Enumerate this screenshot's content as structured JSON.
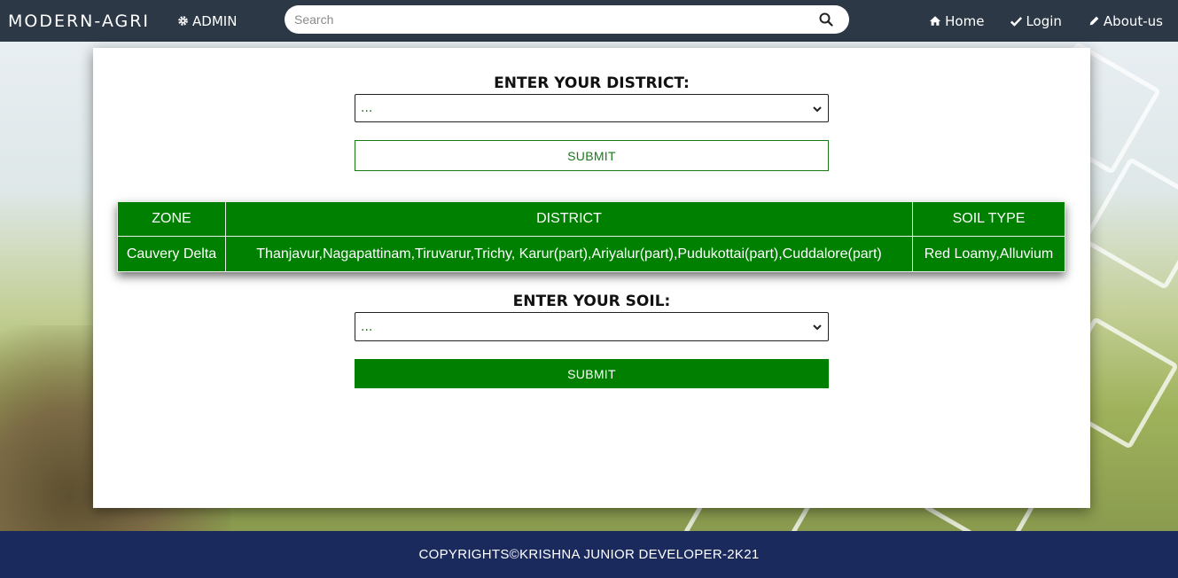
{
  "navbar": {
    "brand": "MODERN-AGRI",
    "admin_label": "ADMIN",
    "search_placeholder": "Search",
    "links": {
      "home": "Home",
      "login": "Login",
      "about": "About-us"
    }
  },
  "form": {
    "district_label": "ENTER YOUR DISTRICT:",
    "district_selected": "...",
    "district_submit": "SUBMIT",
    "soil_label": "ENTER YOUR SOIL:",
    "soil_selected": "...",
    "soil_submit": "SUBMIT"
  },
  "table": {
    "headers": [
      "ZONE",
      "DISTRICT",
      "SOIL TYPE"
    ],
    "rows": [
      [
        "Cauvery Delta",
        "Thanjavur,Nagapattinam,Tiruvarur,Trichy, Karur(part),Ariyalur(part),Pudukottai(part),Cuddalore(part)",
        "Red Loamy,Alluvium"
      ]
    ]
  },
  "footer": {
    "copyright": "COPYRIGHTS©KRISHNA JUNIOR DEVELOPER-2K21"
  },
  "colors": {
    "navbar": "#2c3846",
    "accent_green": "#008000",
    "footer": "#1b2a5c"
  }
}
